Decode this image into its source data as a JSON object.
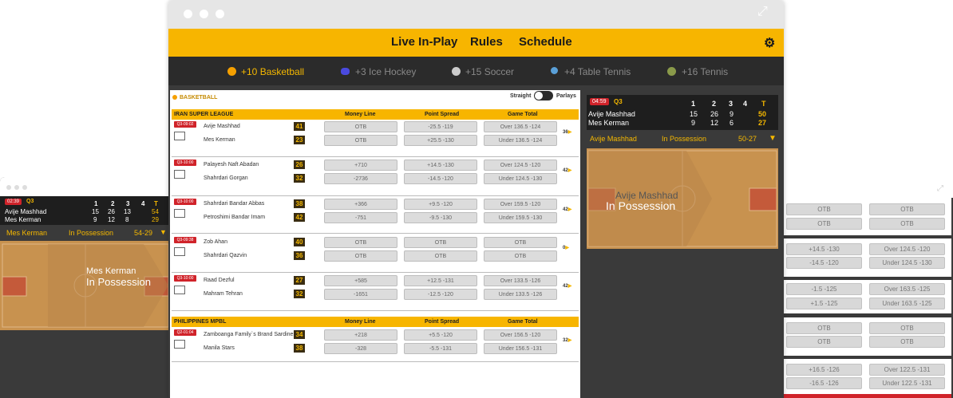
{
  "nav": {
    "live": "Live In-Play",
    "rules": "Rules",
    "schedule": "Schedule"
  },
  "sports": [
    {
      "label": "+10 Basketball",
      "icon": "basketball-icon",
      "color": "#f5a000"
    },
    {
      "label": "+3 Ice Hockey",
      "icon": "hockey-puck-icon",
      "color": "#4a4adf"
    },
    {
      "label": "+15 Soccer",
      "icon": "soccer-ball-icon",
      "color": "#cccccc"
    },
    {
      "label": "+4 Table Tennis",
      "icon": "paddle-icon",
      "color": "#5aa0d8"
    },
    {
      "label": "+16 Tennis",
      "icon": "tennis-ball-icon",
      "color": "#8a9a4a"
    }
  ],
  "section": {
    "title": "BASKETBALL",
    "straight": "Straight",
    "parlays": "Parlays"
  },
  "leagues": [
    {
      "name": "IRAN SUPER LEAGUE",
      "cols": [
        "Money Line",
        "Point Spread",
        "Game Total"
      ]
    },
    {
      "name": "PHILIPPINES MPBL",
      "cols": [
        "Money Line",
        "Point Spread",
        "Game Total"
      ]
    }
  ],
  "games": [
    {
      "tag": "Q3-09:02",
      "t1": "Avije Mashhad",
      "t2": "Mes Kerman",
      "s1": "41",
      "s2": "23",
      "ml1": "OTB",
      "ml2": "OTB",
      "ps1": "-25.5    -119",
      "ps2": "+25.5    -130",
      "gt1": "Over 136.5    -124",
      "gt2": "Under 136.5    -124",
      "more": "36"
    },
    {
      "tag": "Q3-10:00",
      "t1": "Palayesh Naft Abadan",
      "t2": "Shahrdari Gorgan",
      "s1": "26",
      "s2": "32",
      "ml1": "+710",
      "ml2": "-2736",
      "ps1": "+14.5    -130",
      "ps2": "-14.5    -120",
      "gt1": "Over 124.5    -120",
      "gt2": "Under 124.5    -130",
      "more": "42"
    },
    {
      "tag": "Q3-10:00",
      "t1": "Shahrdari Bandar Abbas",
      "t2": "Petroshimi Bandar Imam",
      "s1": "38",
      "s2": "42",
      "ml1": "+366",
      "ml2": "-751",
      "ps1": "+9.5    -120",
      "ps2": "-9.5    -130",
      "gt1": "Over 159.5    -120",
      "gt2": "Under 159.5    -130",
      "more": "42"
    },
    {
      "tag": "Q3-09:38",
      "t1": "Zob Ahan",
      "t2": "Shahrdari Qazvin",
      "s1": "40",
      "s2": "36",
      "ml1": "OTB",
      "ml2": "OTB",
      "ps1": "OTB",
      "ps2": "OTB",
      "gt1": "OTB",
      "gt2": "OTB",
      "more": "0"
    },
    {
      "tag": "Q3-10:00",
      "t1": "Raad Dezful",
      "t2": "Mahram Tehran",
      "s1": "27",
      "s2": "32",
      "ml1": "+585",
      "ml2": "-1651",
      "ps1": "+12.5    -131",
      "ps2": "-12.5    -120",
      "gt1": "Over 133.5    -126",
      "gt2": "Under 133.5    -126",
      "more": "42"
    },
    {
      "tag": "Q2-01:04",
      "t1": "Zamboanga Family`s Brand Sardines",
      "t2": "Manila Stars",
      "s1": "34",
      "s2": "38",
      "ml1": "+218",
      "ml2": "-328",
      "ps1": "+5.5    -120",
      "ps2": "-5.5    -131",
      "gt1": "Over 156.5    -120",
      "gt2": "Under 156.5    -131",
      "more": "32"
    }
  ],
  "panel": {
    "time": "04:59",
    "quarter": "Q3",
    "h": [
      "1",
      "2",
      "3",
      "4",
      "T"
    ],
    "r1": [
      "Avije Mashhad",
      "15",
      "26",
      "9",
      "",
      "50"
    ],
    "r2": [
      "Mes Kerman",
      "9",
      "12",
      "6",
      "",
      "27"
    ],
    "poss_team": "Avije Mashhad",
    "poss": "In Possession",
    "score": "50-27",
    "court_team": "Avije Mashhad",
    "court_poss": "In Possession"
  },
  "lpanel": {
    "time": "02:39",
    "quarter": "Q3",
    "h": [
      "1",
      "2",
      "3",
      "4",
      "T"
    ],
    "r1": [
      "Avije Mashhad",
      "15",
      "26",
      "13",
      "",
      "54"
    ],
    "r2": [
      "Mes Kerman",
      "9",
      "12",
      "8",
      "",
      "29"
    ],
    "poss_team": "Mes Kerman",
    "poss": "In Possession",
    "score": "54-29",
    "court_team": "Mes Kerman",
    "court_poss": "In Possession"
  },
  "rcells": [
    [
      "OTB",
      "OTB"
    ],
    [
      "OTB",
      "OTB"
    ],
    [
      "+14.5    -130",
      "Over 124.5    -120"
    ],
    [
      "-14.5    -120",
      "Under 124.5    -130"
    ],
    [
      "-1.5    -125",
      "Over 163.5    -125"
    ],
    [
      "+1.5    -125",
      "Under 163.5    -125"
    ],
    [
      "OTB",
      "OTB"
    ],
    [
      "OTB",
      "OTB"
    ],
    [
      "+16.5    -126",
      "Over 122.5    -131"
    ],
    [
      "-16.5    -126",
      "Under 122.5    -131"
    ]
  ],
  "more_icon": "chevron-right-icon"
}
